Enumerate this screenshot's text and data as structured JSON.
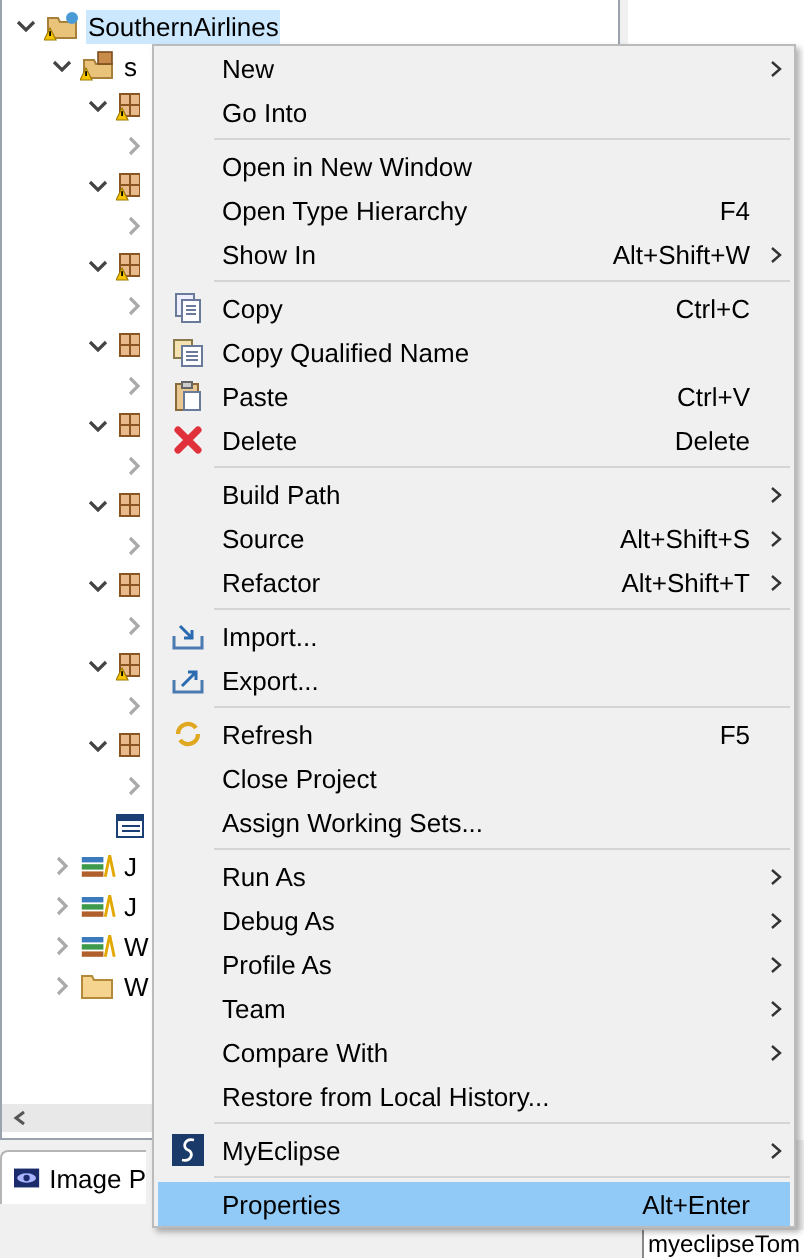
{
  "tree": [
    {
      "label": "SouthernAirlines",
      "kind": "project",
      "warning": true,
      "expanded": true,
      "selected": true,
      "children": [
        {
          "label": "s",
          "kind": "source",
          "warning": true,
          "expanded": true,
          "selected": false,
          "children": [
            {
              "kind": "package",
              "warning": true,
              "expanded": true,
              "children": [
                {
                  "expanded": false
                }
              ]
            },
            {
              "kind": "package",
              "warning": true,
              "expanded": true,
              "children": [
                {
                  "expanded": false
                }
              ]
            },
            {
              "kind": "package",
              "warning": true,
              "expanded": true,
              "children": [
                {
                  "expanded": false
                }
              ]
            },
            {
              "kind": "package",
              "warning": false,
              "expanded": true,
              "children": [
                {
                  "expanded": false
                }
              ]
            },
            {
              "kind": "package",
              "warning": false,
              "expanded": true,
              "children": [
                {
                  "expanded": false
                }
              ]
            },
            {
              "kind": "package",
              "warning": false,
              "expanded": true,
              "children": [
                {
                  "expanded": false
                }
              ]
            },
            {
              "kind": "package",
              "warning": false,
              "expanded": true,
              "children": [
                {
                  "expanded": false
                }
              ]
            },
            {
              "kind": "package",
              "warning": true,
              "expanded": true,
              "children": [
                {
                  "expanded": false
                }
              ]
            },
            {
              "kind": "package",
              "warning": false,
              "expanded": true,
              "children": [
                {
                  "expanded": false
                }
              ]
            },
            {
              "kind": "file"
            }
          ]
        },
        {
          "label": "J",
          "kind": "library",
          "warning": false,
          "expanded": false,
          "selected": false
        },
        {
          "label": "J",
          "kind": "library",
          "warning": false,
          "expanded": false,
          "selected": false
        },
        {
          "label": "W",
          "kind": "library",
          "warning": false,
          "expanded": false,
          "selected": false
        },
        {
          "label": "W",
          "kind": "folder",
          "warning": false,
          "expanded": false,
          "selected": false
        }
      ]
    }
  ],
  "bottom_panel": {
    "tab": "Image P",
    "console": "myeclipseTom"
  },
  "context_menu": [
    [
      {
        "label": "New",
        "submenu": true,
        "selected": false
      },
      {
        "label": "Go Into",
        "submenu": false,
        "selected": false
      }
    ],
    [
      {
        "label": "Open in New Window",
        "submenu": false,
        "selected": false
      },
      {
        "label": "Open Type Hierarchy",
        "shortcut": "F4",
        "submenu": false,
        "selected": false
      },
      {
        "label": "Show In",
        "shortcut": "Alt+Shift+W",
        "submenu": true,
        "selected": false
      }
    ],
    [
      {
        "label": "Copy",
        "shortcut": "Ctrl+C",
        "submenu": false,
        "selected": false
      },
      {
        "label": "Copy Qualified Name",
        "submenu": false,
        "selected": false
      },
      {
        "label": "Paste",
        "shortcut": "Ctrl+V",
        "submenu": false,
        "selected": false
      },
      {
        "label": "Delete",
        "shortcut": "Delete",
        "submenu": false,
        "selected": false
      }
    ],
    [
      {
        "label": "Build Path",
        "submenu": true,
        "selected": false
      },
      {
        "label": "Source",
        "shortcut": "Alt+Shift+S",
        "submenu": true,
        "selected": false
      },
      {
        "label": "Refactor",
        "shortcut": "Alt+Shift+T",
        "submenu": true,
        "selected": false
      }
    ],
    [
      {
        "label": "Import...",
        "submenu": false,
        "selected": false
      },
      {
        "label": "Export...",
        "submenu": false,
        "selected": false
      }
    ],
    [
      {
        "label": "Refresh",
        "shortcut": "F5",
        "submenu": false,
        "selected": false
      },
      {
        "label": "Close Project",
        "submenu": false,
        "selected": false
      },
      {
        "label": "Assign Working Sets...",
        "submenu": false,
        "selected": false
      }
    ],
    [
      {
        "label": "Run As",
        "submenu": true,
        "selected": false
      },
      {
        "label": "Debug As",
        "submenu": true,
        "selected": false
      },
      {
        "label": "Profile As",
        "submenu": true,
        "selected": false
      },
      {
        "label": "Team",
        "submenu": true,
        "selected": false
      },
      {
        "label": "Compare With",
        "submenu": true,
        "selected": false
      },
      {
        "label": "Restore from Local History...",
        "submenu": false,
        "selected": false
      }
    ],
    [
      {
        "label": "MyEclipse",
        "submenu": true,
        "selected": false
      }
    ],
    [
      {
        "label": "Properties",
        "shortcut": "Alt+Enter",
        "submenu": false,
        "selected": true
      }
    ]
  ]
}
